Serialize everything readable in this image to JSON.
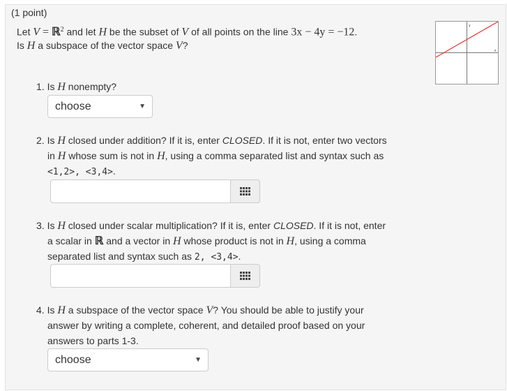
{
  "header": {
    "points": "(1 point)"
  },
  "statement": {
    "let": "Let",
    "V": "V",
    "eq": "=",
    "R": "ℝ",
    "sup2": "2",
    "and_let": " and let ",
    "H": "H",
    "subset_text": " be the subset of ",
    "V2": "V",
    "points_text": " of all points on the line ",
    "line_eq": "3x − 4y = −12",
    "period": ".",
    "is": "Is ",
    "H2": "H",
    "subspace_text": " a subspace of the vector space ",
    "V3": "V",
    "q": "?"
  },
  "graph": {
    "y_label": "y",
    "x_label": "x"
  },
  "q1": {
    "num": "1. Is ",
    "H": "H",
    "text": " nonempty?",
    "select_value": "choose"
  },
  "q2": {
    "num": "2. Is ",
    "H": "H",
    "line1a": " closed under addition? If it is, enter ",
    "closed": "CLOSED",
    "line1b": ". If it is not, enter two vectors",
    "line2a": "in ",
    "H2": "H",
    "line2b": " whose sum is not in ",
    "H3": "H",
    "line2c": ", using a comma separated list and syntax such as",
    "example": "<1,2>, <3,4>",
    "period": ".",
    "input_value": ""
  },
  "q3": {
    "num": "3. Is ",
    "H": "H",
    "line1a": " closed under scalar multiplication? If it is, enter ",
    "closed": "CLOSED",
    "line1b": ". If it is not, enter",
    "line2a": "a scalar in ",
    "R": "ℝ",
    "line2b": " and a vector in ",
    "H2": "H",
    "line2c": " whose product is not in ",
    "H3": "H",
    "line2d": ", using a comma",
    "line3a": "separated list and syntax such as ",
    "example": "2, <3,4>",
    "period": ".",
    "input_value": ""
  },
  "q4": {
    "num": "4. Is ",
    "H": "H",
    "line1a": " a subspace of the vector space ",
    "V": "V",
    "line1b": "? You should be able to justify your",
    "line2": "answer by writing a complete, coherent, and detailed proof based on your",
    "line3": "answers to parts 1-3.",
    "select_value": "choose"
  },
  "icons": {
    "caret": "caret-down-icon",
    "grid": "grid-icon"
  },
  "colors": {
    "line": "#e53935",
    "panel_bg": "#f5f5f5",
    "addon_bg": "#eeeeee",
    "border": "#cccccc"
  }
}
